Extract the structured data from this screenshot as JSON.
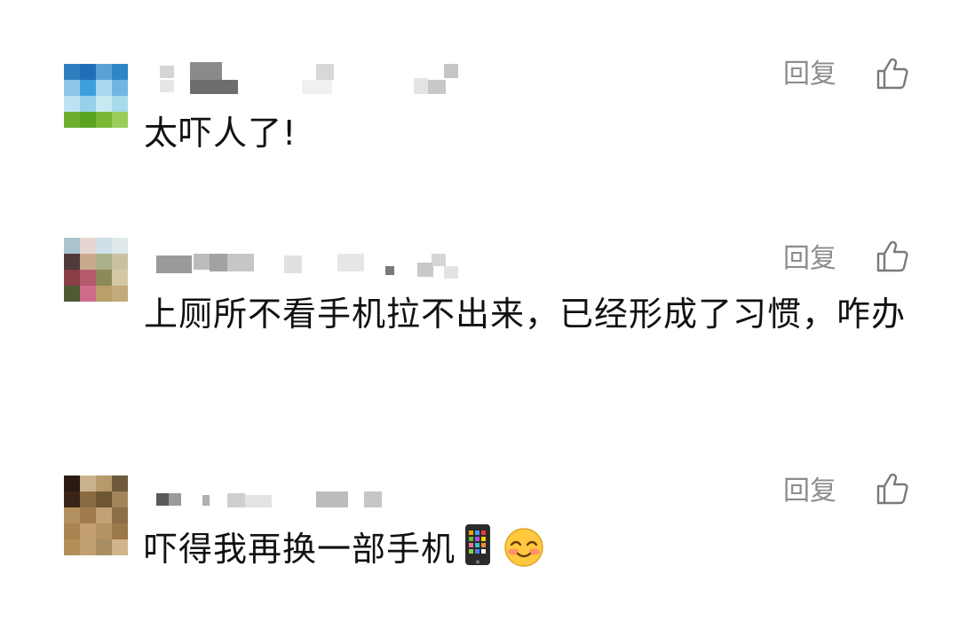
{
  "comments": [
    {
      "text": "太吓人了!",
      "reply_label": "回复"
    },
    {
      "text": "上厕所不看手机拉不出来，已经形成了习惯，咋办",
      "reply_label": "回复"
    },
    {
      "text": "吓得我再换一部手机",
      "reply_label": "回复",
      "emojis": [
        "mobile-phone-emoji",
        "smiling-face-emoji"
      ]
    }
  ],
  "icons": {
    "like": "thumbs-up-icon"
  },
  "colors": {
    "reply_text": "#8c8c8c",
    "comment_text": "#111111",
    "background": "#ffffff"
  }
}
